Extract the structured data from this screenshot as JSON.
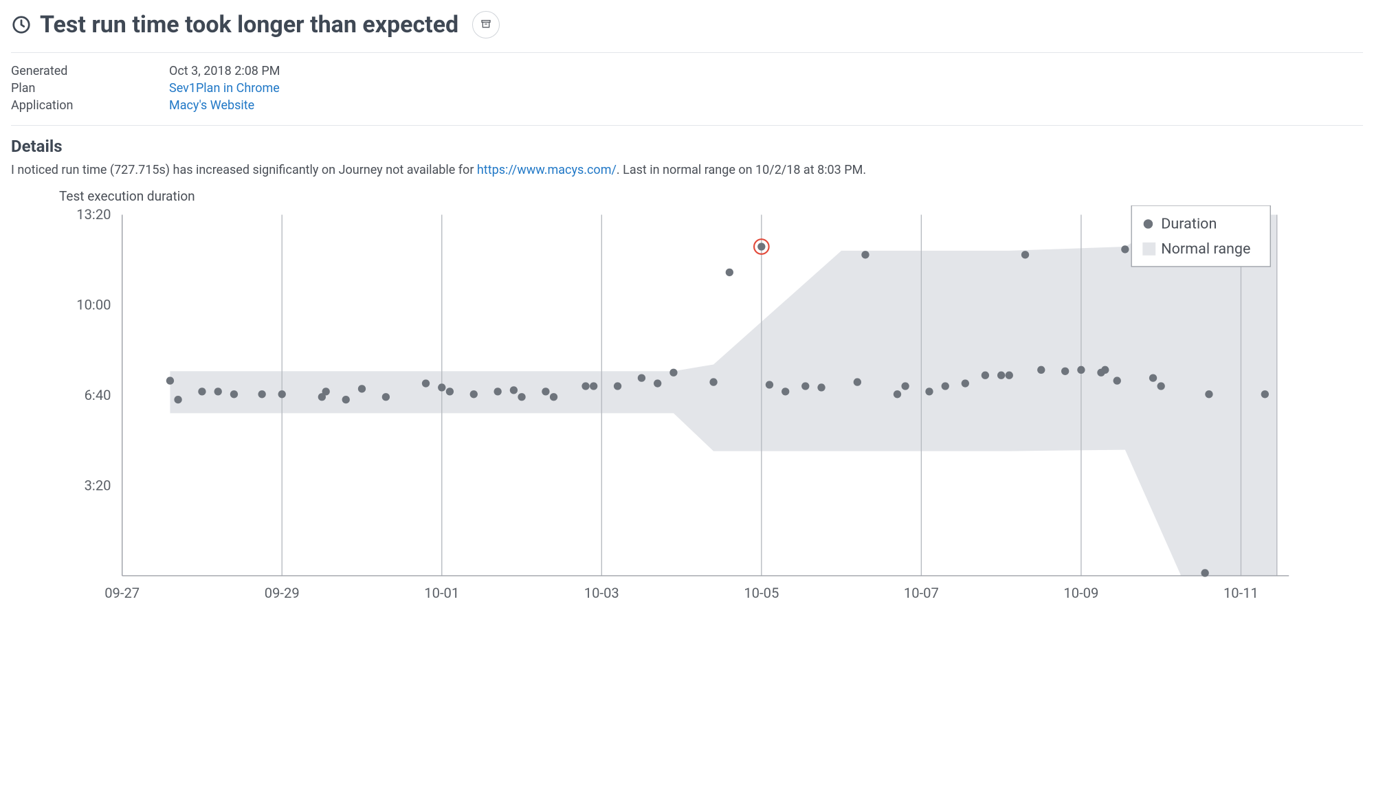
{
  "header": {
    "title": "Test run time took longer than expected"
  },
  "meta": {
    "generated_label": "Generated",
    "generated_value": "Oct 3, 2018 2:08 PM",
    "plan_label": "Plan",
    "plan_value": "Sev1Plan in Chrome",
    "application_label": "Application",
    "application_value": "Macy's Website"
  },
  "details": {
    "heading": "Details",
    "pre_link": "I noticed run time (727.715s) has increased significantly on Journey not available for ",
    "link_text": "https://www.macys.com/",
    "post_link": ". Last in normal range on 10/2/18 at 8:03 PM."
  },
  "legend": {
    "duration": "Duration",
    "normal_range": "Normal range"
  },
  "chart_data": {
    "type": "scatter",
    "title": "Test execution duration",
    "xlabel": "",
    "ylabel": "",
    "y_ticks": [
      "13:20",
      "10:00",
      "6:40",
      "3:20"
    ],
    "y_range_minutes": [
      0,
      13.33
    ],
    "x_ticks": [
      "09-27",
      "09-29",
      "10-01",
      "10-03",
      "10-05",
      "10-07",
      "10-09",
      "10-11"
    ],
    "x_range_days": [
      0,
      14.6
    ],
    "series": [
      {
        "name": "Duration",
        "x_days": [
          0.6,
          0.7,
          1.0,
          1.2,
          1.4,
          1.75,
          2.0,
          2.5,
          2.55,
          2.8,
          3.0,
          3.3,
          3.8,
          4.0,
          4.1,
          4.4,
          4.7,
          4.9,
          5.0,
          5.3,
          5.4,
          5.8,
          5.9,
          6.2,
          6.5,
          6.7,
          6.9,
          7.4,
          7.6,
          8.0,
          8.1,
          8.3,
          8.55,
          8.75,
          9.2,
          9.3,
          9.7,
          9.8,
          10.1,
          10.3,
          10.55,
          10.8,
          11.0,
          11.1,
          11.3,
          11.5,
          11.8,
          12.0,
          12.25,
          12.3,
          12.45,
          12.55,
          12.9,
          13.0,
          13.55,
          13.6,
          14.3
        ],
        "y_minutes": [
          7.2,
          6.5,
          6.8,
          6.8,
          6.7,
          6.7,
          6.7,
          6.6,
          6.8,
          6.5,
          6.9,
          6.6,
          7.1,
          6.95,
          6.8,
          6.7,
          6.8,
          6.85,
          6.6,
          6.8,
          6.6,
          7.0,
          7.0,
          7.0,
          7.3,
          7.1,
          7.5,
          7.15,
          11.2,
          12.15,
          7.05,
          6.8,
          7.0,
          6.95,
          7.15,
          11.85,
          6.7,
          7.0,
          6.8,
          7.0,
          7.1,
          7.4,
          7.4,
          7.4,
          11.85,
          7.6,
          7.55,
          7.6,
          7.5,
          7.6,
          7.2,
          12.05,
          7.3,
          7.0,
          0.1,
          6.7,
          6.7
        ],
        "highlight_index": 29
      }
    ],
    "normal_range": {
      "x_days": [
        0.6,
        6.9,
        7.4,
        9.0,
        11.1,
        12.55,
        13.25,
        14.45
      ],
      "upper_min": [
        7.55,
        7.55,
        7.8,
        12.0,
        12.0,
        12.15,
        13.33,
        13.33
      ],
      "lower_min": [
        6.0,
        6.0,
        4.6,
        4.6,
        4.6,
        4.65,
        0.0,
        0.0
      ]
    }
  }
}
